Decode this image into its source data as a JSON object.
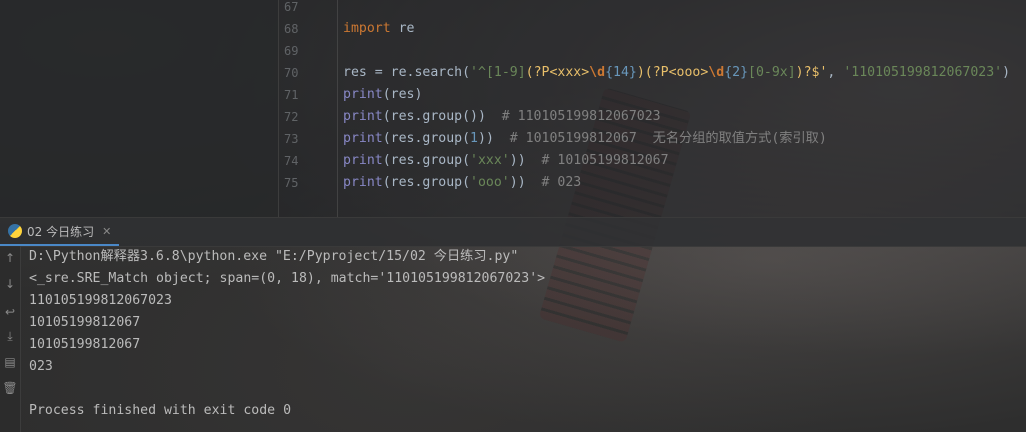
{
  "editor": {
    "lines": [
      {
        "no": "67",
        "segments": []
      },
      {
        "no": "68",
        "segments": [
          {
            "t": "import",
            "c": "kw"
          },
          {
            "t": " re",
            "c": ""
          }
        ]
      },
      {
        "no": "69",
        "segments": []
      },
      {
        "no": "70",
        "segments": [
          {
            "t": "res = re.search(",
            "c": ""
          },
          {
            "t": "'^",
            "c": "str"
          },
          {
            "t": "[1-9]",
            "c": "rx"
          },
          {
            "t": "(?P<xxx>",
            "c": "rxg"
          },
          {
            "t": "\\d",
            "c": "rxe"
          },
          {
            "t": "{14}",
            "c": "rxn"
          },
          {
            "t": ")(?P<ooo>",
            "c": "rxg"
          },
          {
            "t": "\\d",
            "c": "rxe"
          },
          {
            "t": "{2}",
            "c": "rxn"
          },
          {
            "t": "[0-9x]",
            "c": "rx"
          },
          {
            "t": ")?$'",
            "c": "rxg"
          },
          {
            "t": ", ",
            "c": ""
          },
          {
            "t": "'110105199812067023'",
            "c": "str"
          },
          {
            "t": ")",
            "c": ""
          }
        ]
      },
      {
        "no": "71",
        "segments": [
          {
            "t": "print",
            "c": "fn"
          },
          {
            "t": "(res)",
            "c": ""
          }
        ]
      },
      {
        "no": "72",
        "segments": [
          {
            "t": "print",
            "c": "fn"
          },
          {
            "t": "(res.group())  ",
            "c": ""
          },
          {
            "t": "# 110105199812067023",
            "c": "cm"
          }
        ]
      },
      {
        "no": "73",
        "segments": [
          {
            "t": "print",
            "c": "fn"
          },
          {
            "t": "(res.group(",
            "c": ""
          },
          {
            "t": "1",
            "c": "rxn"
          },
          {
            "t": "))  ",
            "c": ""
          },
          {
            "t": "# 10105199812067  无名分组的取值方式(索引取)",
            "c": "cm"
          }
        ]
      },
      {
        "no": "74",
        "segments": [
          {
            "t": "print",
            "c": "fn"
          },
          {
            "t": "(res.group(",
            "c": ""
          },
          {
            "t": "'xxx'",
            "c": "str"
          },
          {
            "t": "))  ",
            "c": ""
          },
          {
            "t": "# 10105199812067",
            "c": "cm"
          }
        ]
      },
      {
        "no": "75",
        "segments": [
          {
            "t": "print",
            "c": "fn"
          },
          {
            "t": "(res.group(",
            "c": ""
          },
          {
            "t": "'ooo'",
            "c": "str"
          },
          {
            "t": "))  ",
            "c": ""
          },
          {
            "t": "# 023",
            "c": "cm"
          }
        ]
      }
    ]
  },
  "run": {
    "tab_label": "02 今日练习",
    "tab_close": "✕",
    "console": [
      "D:\\Python解释器3.6.8\\python.exe \"E:/Pyproject/15/02 今日练习.py\"",
      "<_sre.SRE_Match object; span=(0, 18), match='110105199812067023'>",
      "110105199812067023",
      "10105199812067",
      "10105199812067",
      "023",
      "",
      "Process finished with exit code 0"
    ]
  },
  "toolbar_icons": [
    "up-arrow-icon",
    "down-arrow-icon",
    "soft-wrap-icon",
    "scroll-to-end-icon",
    "print-icon",
    "trash-icon"
  ]
}
